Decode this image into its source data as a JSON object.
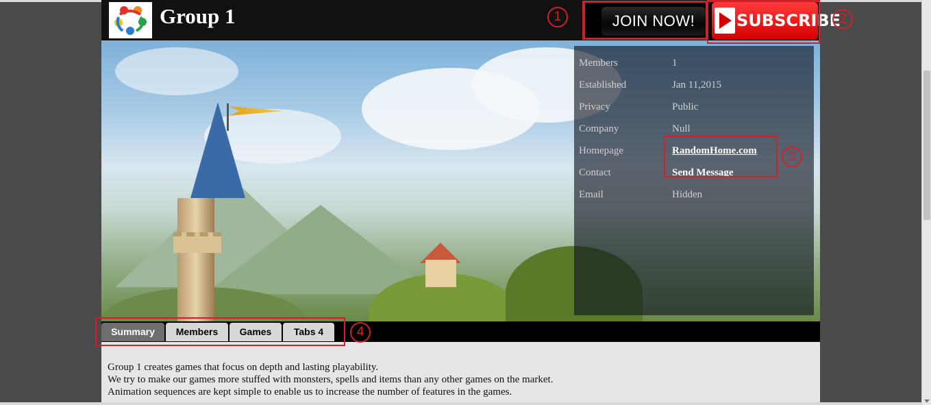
{
  "header": {
    "title": "Group 1",
    "join_label": "JOIN NOW!",
    "subscribe_label": "SUBSCRIBE"
  },
  "info": [
    {
      "key": "Members",
      "value": "1",
      "link": false
    },
    {
      "key": "Established",
      "value": "Jan 11,2015",
      "link": false
    },
    {
      "key": "Privacy",
      "value": "Public",
      "link": false
    },
    {
      "key": "Company",
      "value": "Null",
      "link": false
    },
    {
      "key": "Homepage",
      "value": "RandomHome.com",
      "link": true
    },
    {
      "key": "Contact",
      "value": "Send Message",
      "link": true
    },
    {
      "key": "Email",
      "value": "Hidden",
      "link": false
    }
  ],
  "tabs": [
    {
      "label": "Summary",
      "active": true
    },
    {
      "label": "Members",
      "active": false
    },
    {
      "label": "Games",
      "active": false
    },
    {
      "label": "Tabs 4",
      "active": false
    }
  ],
  "annotations": [
    "1",
    "2",
    "3",
    "4"
  ],
  "content": {
    "lines": [
      "Group 1 creates games that focus on depth and lasting playability.",
      "We try to make our games more stuffed with monsters, spells and items than any other games on the market.",
      "Animation sequences are kept simple to enable us to increase the number of features in the games."
    ]
  },
  "colors": {
    "annotation_red": "#d0202a",
    "header_bg": "#111111",
    "active_tab": "#6e6e6e",
    "content_bg": "#e6e6e6"
  }
}
